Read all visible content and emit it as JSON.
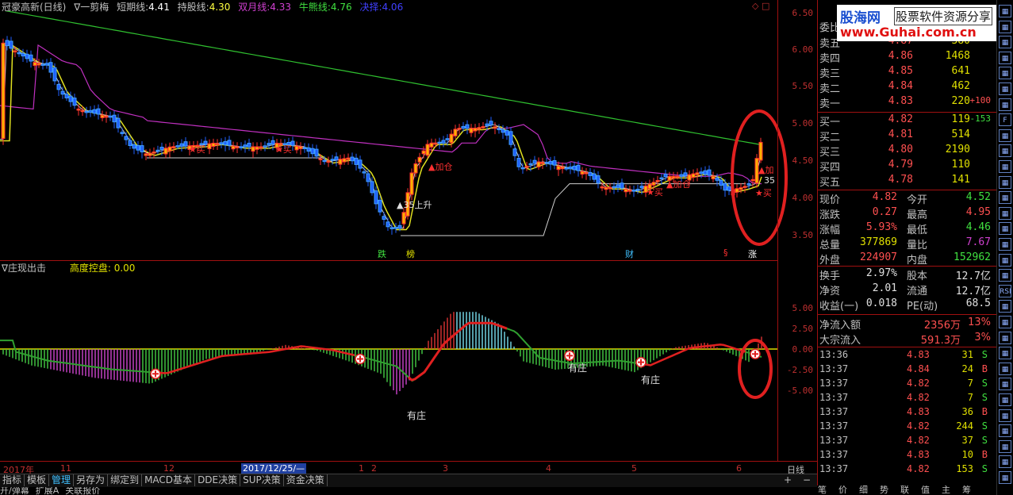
{
  "header": {
    "stock_name": "冠豪高新(日线)",
    "indicator_name": "∇一剪梅",
    "items": [
      {
        "label": "短期线:",
        "value": "4.41",
        "color": "#ffffff"
      },
      {
        "label": "持股线:",
        "value": "4.30",
        "color": "#ffff40"
      },
      {
        "label": "双月线:",
        "value": "4.33",
        "color": "#d040d0"
      },
      {
        "label": "牛熊线:",
        "value": "4.76",
        "color": "#40e040"
      },
      {
        "label": "决择:",
        "value": "4.06",
        "color": "#4040ff"
      }
    ]
  },
  "price_axis": [
    "6.50",
    "6.00",
    "5.50",
    "5.00",
    "4.50",
    "4.00",
    "3.50"
  ],
  "annotations": {
    "buy1": "★买",
    "buy2": "★买",
    "rise": "▲35上升",
    "add1": "▲加仓",
    "buy3": "★买",
    "add2": "▲加仓",
    "add3": "▲加",
    "n35": "35",
    "buy4": "★买",
    "evt1": "跌",
    "evt2": "榜",
    "evt3": "财",
    "evt4": "§",
    "evt5": "涨"
  },
  "indicator": {
    "title": "∇庄现出击",
    "subtitle": "高度控盘: 0.00",
    "axis": [
      "5.00",
      "2.50",
      "0.00",
      "-2.50",
      "-5.00"
    ],
    "labels": [
      "有庄",
      "有庄",
      "有庄"
    ]
  },
  "time_axis": {
    "labels": [
      "2017年",
      "11",
      "12",
      "2017/12/25/—",
      "1",
      "2",
      "3",
      "4",
      "5",
      "6"
    ],
    "period": "日线"
  },
  "bottom_tabs": [
    "指标",
    "模板",
    "管理",
    "另存为",
    "绑定到",
    "MACD基本",
    "DDE决策",
    "SUP决策",
    "资金决策"
  ],
  "bottom_tabs_active": "管理",
  "bottom_ctrl": [
    "+",
    "−"
  ],
  "bottom_row2": [
    "开/弹幕",
    "扩展A",
    "关联报价"
  ],
  "quote": {
    "wei_label": "委比",
    "sell": [
      {
        "label": "卖五",
        "price": "4.87",
        "vol": "380",
        "chg": ""
      },
      {
        "label": "卖四",
        "price": "4.86",
        "vol": "1468",
        "chg": ""
      },
      {
        "label": "卖三",
        "price": "4.85",
        "vol": "641",
        "chg": ""
      },
      {
        "label": "卖二",
        "price": "4.84",
        "vol": "462",
        "chg": ""
      },
      {
        "label": "卖一",
        "price": "4.83",
        "vol": "220",
        "chg": "+100"
      }
    ],
    "buy": [
      {
        "label": "买一",
        "price": "4.82",
        "vol": "119",
        "chg": "-153"
      },
      {
        "label": "买二",
        "price": "4.81",
        "vol": "514",
        "chg": ""
      },
      {
        "label": "买三",
        "price": "4.80",
        "vol": "2190",
        "chg": ""
      },
      {
        "label": "买四",
        "price": "4.79",
        "vol": "110",
        "chg": ""
      },
      {
        "label": "买五",
        "price": "4.78",
        "vol": "141",
        "chg": ""
      }
    ],
    "stats": [
      {
        "l1": "现价",
        "v1": "4.82",
        "c1": "#ff5050",
        "l2": "今开",
        "v2": "4.52",
        "c2": "#40e040"
      },
      {
        "l1": "涨跌",
        "v1": "0.27",
        "c1": "#ff5050",
        "l2": "最高",
        "v2": "4.95",
        "c2": "#ff5050"
      },
      {
        "l1": "涨幅",
        "v1": "5.93%",
        "c1": "#ff5050",
        "l2": "最低",
        "v2": "4.46",
        "c2": "#40e040"
      },
      {
        "l1": "总量",
        "v1": "377869",
        "c1": "#e0e000",
        "l2": "量比",
        "v2": "7.67",
        "c2": "#d040d0"
      },
      {
        "l1": "外盘",
        "v1": "224907",
        "c1": "#ff5050",
        "l2": "内盘",
        "v2": "152962",
        "c2": "#40e040"
      }
    ],
    "stats2": [
      {
        "l1": "换手",
        "v1": "2.97%",
        "l2": "股本",
        "v2": "12.7亿"
      },
      {
        "l1": "净资",
        "v1": "2.01",
        "l2": "流通",
        "v2": "12.7亿"
      },
      {
        "l1": "收益(一)",
        "v1": "0.018",
        "l2": "PE(动)",
        "v2": "68.5"
      }
    ],
    "flow": [
      {
        "label": "净流入额",
        "value": "2356万",
        "pct": "13%"
      },
      {
        "label": "大宗流入",
        "value": "591.3万",
        "pct": "3%"
      }
    ],
    "ticks": [
      {
        "time": "13:36",
        "price": "4.83",
        "vol": "31",
        "dir": "S"
      },
      {
        "time": "13:37",
        "price": "4.84",
        "vol": "24",
        "dir": "B"
      },
      {
        "time": "13:37",
        "price": "4.82",
        "vol": "7",
        "dir": "S"
      },
      {
        "time": "13:37",
        "price": "4.82",
        "vol": "7",
        "dir": "S"
      },
      {
        "time": "13:37",
        "price": "4.83",
        "vol": "36",
        "dir": "B"
      },
      {
        "time": "13:37",
        "price": "4.82",
        "vol": "244",
        "dir": "S"
      },
      {
        "time": "13:37",
        "price": "4.82",
        "vol": "37",
        "dir": "S"
      },
      {
        "time": "13:37",
        "price": "4.83",
        "vol": "10",
        "dir": "B"
      },
      {
        "time": "13:37",
        "price": "4.82",
        "vol": "153",
        "dir": "S"
      }
    ],
    "bottom_tabs": [
      "笔",
      "价",
      "细",
      "势",
      "联",
      "值",
      "主",
      "筹"
    ]
  },
  "logo": {
    "line1a": "股海网",
    "line1b": "股票软件资源分享",
    "line2": "www.Guhai.com.cn"
  },
  "toolbar_icons": [
    "window-icon",
    "list-icon",
    "grid-icon",
    "table-icon",
    "table-icon",
    "table-icon",
    "table-icon",
    "f10-icon",
    "chart-icon",
    "chart-icon",
    "chart-icon",
    "chart-icon",
    "chart-icon",
    "chart-icon",
    "chart-icon",
    "chart-icon",
    "chart-icon",
    "chart-icon",
    "rsi-icon",
    "move-icon",
    "pen-icon",
    "tool-icon",
    "tool-icon",
    "tool-icon",
    "tool-icon",
    "tool-icon",
    "tool-icon",
    "tool-icon",
    "tool-icon",
    "tool-icon",
    "tool-icon"
  ],
  "colors": {
    "up": "#ff3030",
    "down": "#2060ff",
    "accent": "#a01010"
  }
}
